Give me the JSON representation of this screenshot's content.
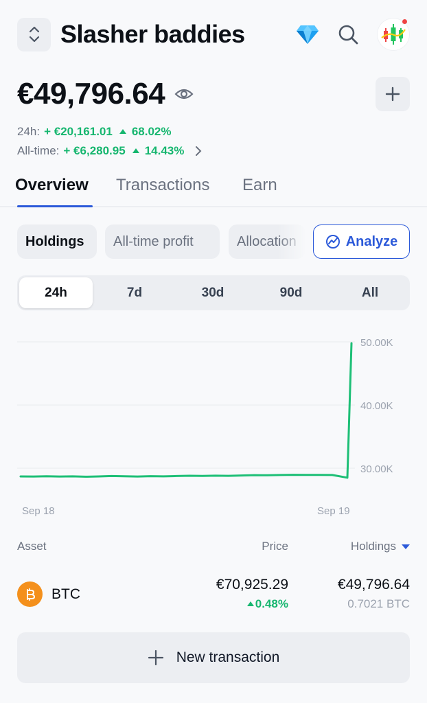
{
  "header": {
    "title": "Slasher baddies",
    "icons": [
      "updown-chevron-icon",
      "diamond-icon",
      "search-icon",
      "avatar-candles-icon"
    ]
  },
  "portfolio": {
    "balance": "€49,796.64",
    "change_24h": {
      "label": "24h:",
      "amount": "+ €20,161.01",
      "percent": "68.02%"
    },
    "change_all": {
      "label": "All-time:",
      "amount": "+ €6,280.95",
      "percent": "14.43%"
    }
  },
  "tabs": [
    {
      "label": "Overview",
      "active": true
    },
    {
      "label": "Transactions",
      "active": false
    },
    {
      "label": "Earn",
      "active": false
    }
  ],
  "chips": [
    {
      "label": "Holdings",
      "active": true
    },
    {
      "label": "All-time profit",
      "active": false
    },
    {
      "label": "Allocation",
      "active": false
    }
  ],
  "analyze_label": "Analyze",
  "periods": [
    {
      "label": "24h",
      "active": true
    },
    {
      "label": "7d",
      "active": false
    },
    {
      "label": "30d",
      "active": false
    },
    {
      "label": "90d",
      "active": false
    },
    {
      "label": "All",
      "active": false
    }
  ],
  "chart_data": {
    "type": "line",
    "x_labels": [
      "Sep 18",
      "Sep 19"
    ],
    "y_ticks": [
      {
        "value": 50000,
        "label": "50.00K"
      },
      {
        "value": 40000,
        "label": "40.00K"
      },
      {
        "value": 30000,
        "label": "30.00K"
      }
    ],
    "ylim": [
      29000,
      51000
    ],
    "series": [
      {
        "values": [
          28700,
          28680,
          28720,
          28690,
          28710,
          28650,
          28700,
          28760,
          28720,
          28690,
          28740,
          28710,
          28760,
          28800,
          28780,
          28820,
          28790,
          28850,
          28900,
          28880,
          28920,
          28960,
          28940,
          28950,
          28920,
          28500,
          49796
        ],
        "color": "#1dbf76"
      }
    ],
    "grid": true
  },
  "assets_table": {
    "headers": {
      "asset": "Asset",
      "price": "Price",
      "holdings": "Holdings"
    },
    "rows": [
      {
        "symbol": "BTC",
        "price": "€70,925.29",
        "change": "0.48%",
        "holdings_value": "€49,796.64",
        "holdings_qty": "0.7021 BTC"
      }
    ]
  },
  "new_transaction_label": "New transaction",
  "colors": {
    "accent": "#2b59d9",
    "positive": "#16b66f",
    "btc": "#f4901c"
  }
}
